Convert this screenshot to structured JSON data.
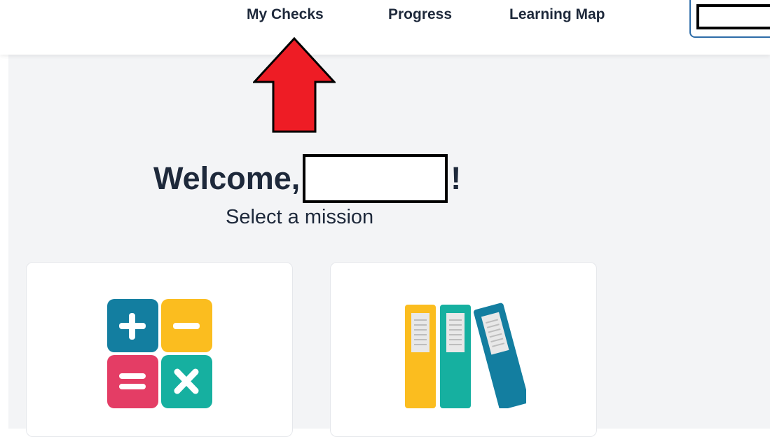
{
  "nav": {
    "items": [
      {
        "label": "My Checks"
      },
      {
        "label": "Progress"
      },
      {
        "label": "Learning Map"
      }
    ]
  },
  "welcome": {
    "prefix": "Welcome,",
    "suffix": "!",
    "subtitle": "Select a mission"
  },
  "missions": [
    {
      "icon": "math-operations-icon"
    },
    {
      "icon": "books-icon"
    }
  ],
  "annotation": {
    "arrow_color": "#ee1c25"
  },
  "colors": {
    "text": "#1e293b",
    "background": "#f3f4f6",
    "accent_blue": "#2d6ca8"
  }
}
